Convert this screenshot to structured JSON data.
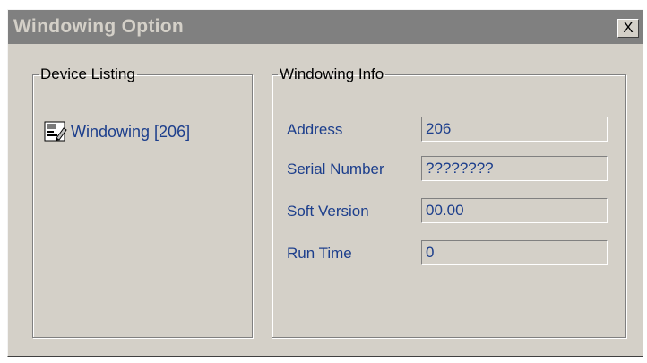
{
  "window": {
    "title": "Windowing Option",
    "close_label": "X"
  },
  "device_listing": {
    "legend": "Device Listing",
    "items": [
      {
        "label": "Windowing [206]",
        "icon": "device-icon"
      }
    ]
  },
  "windowing_info": {
    "legend": "Windowing Info",
    "fields": [
      {
        "label": "Address",
        "value": "206"
      },
      {
        "label": "Serial Number",
        "value": "????????"
      },
      {
        "label": "Soft Version",
        "value": "00.00"
      },
      {
        "label": "Run Time",
        "value": "0"
      }
    ]
  },
  "colors": {
    "title_bar": "#808080",
    "window_bg": "#d4d0c8",
    "text_accent": "#1c3e8c"
  }
}
